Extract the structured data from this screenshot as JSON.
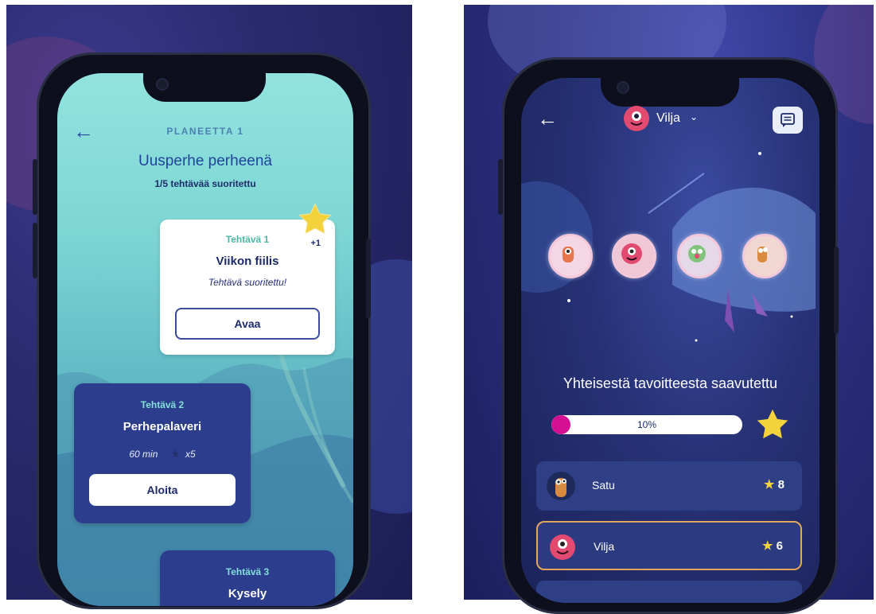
{
  "left": {
    "back_icon": "arrow-left-icon",
    "planet_label": "PLANEETTA 1",
    "title": "Uusperhe perheenä",
    "progress_text": "1/5 tehtävää suoritettu",
    "tasks": [
      {
        "label": "Tehtävä 1",
        "title": "Viikon fiilis",
        "status": "Tehtävä suoritettu!",
        "reward": "+1",
        "button": "Avaa"
      },
      {
        "label": "Tehtävä 2",
        "title": "Perhepalaveri",
        "duration": "60 min",
        "reward": "x5",
        "button": "Aloita"
      },
      {
        "label": "Tehtävä 3",
        "title": "Kysely"
      }
    ],
    "colors": {
      "screen_bg": "#92e3df",
      "card_blue": "#2b3d8c",
      "accent_teal": "#4ab7a7",
      "star": "#f4d23c"
    }
  },
  "right": {
    "back_icon": "arrow-left-icon",
    "user_name": "Vilja",
    "chevron_icon": "chevron-down-icon",
    "chat_icon": "message-icon",
    "goal_heading": "Yhteisestä tavoitteesta saavutettu",
    "goal_percent": 10,
    "goal_percent_label": "10%",
    "members": [
      {
        "name": "Satu",
        "stars": "8",
        "avatar": "orange-monster-avatar"
      },
      {
        "name": "Vilja",
        "stars": "6",
        "avatar": "pink-monster-avatar",
        "selected": true
      }
    ],
    "colors": {
      "bar_fill": "#d40f91",
      "row_bg": "#2f3f86",
      "selected_border": "#e3a65a",
      "star": "#f4d23c"
    }
  }
}
